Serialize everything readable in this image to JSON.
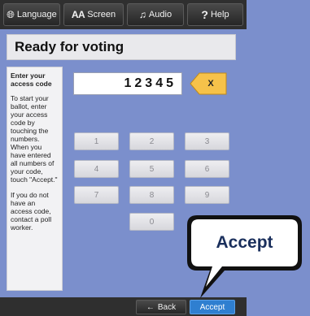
{
  "toolbar": {
    "language_label": "Language",
    "screen_prefix": "AA",
    "screen_label": "Screen",
    "audio_label": "Audio",
    "help_label": "Help"
  },
  "title": "Ready for voting",
  "instructions": {
    "heading": "Enter your access code",
    "para1": "To start your ballot, enter your access code by touching the numbers. When you have entered all numbers of your code, touch \"Accept.\"",
    "para2": "If you do not have an access code, contact a poll worker."
  },
  "code_value": "12345",
  "clear_label": "X",
  "keypad": [
    "1",
    "2",
    "3",
    "4",
    "5",
    "6",
    "7",
    "8",
    "9",
    "0"
  ],
  "bottom": {
    "back_label": "Back",
    "accept_label": "Accept"
  },
  "callout_label": "Accept",
  "colors": {
    "background": "#7b8fcc",
    "accent": "#2f7fd0",
    "clear_button": "#f6c24a"
  }
}
